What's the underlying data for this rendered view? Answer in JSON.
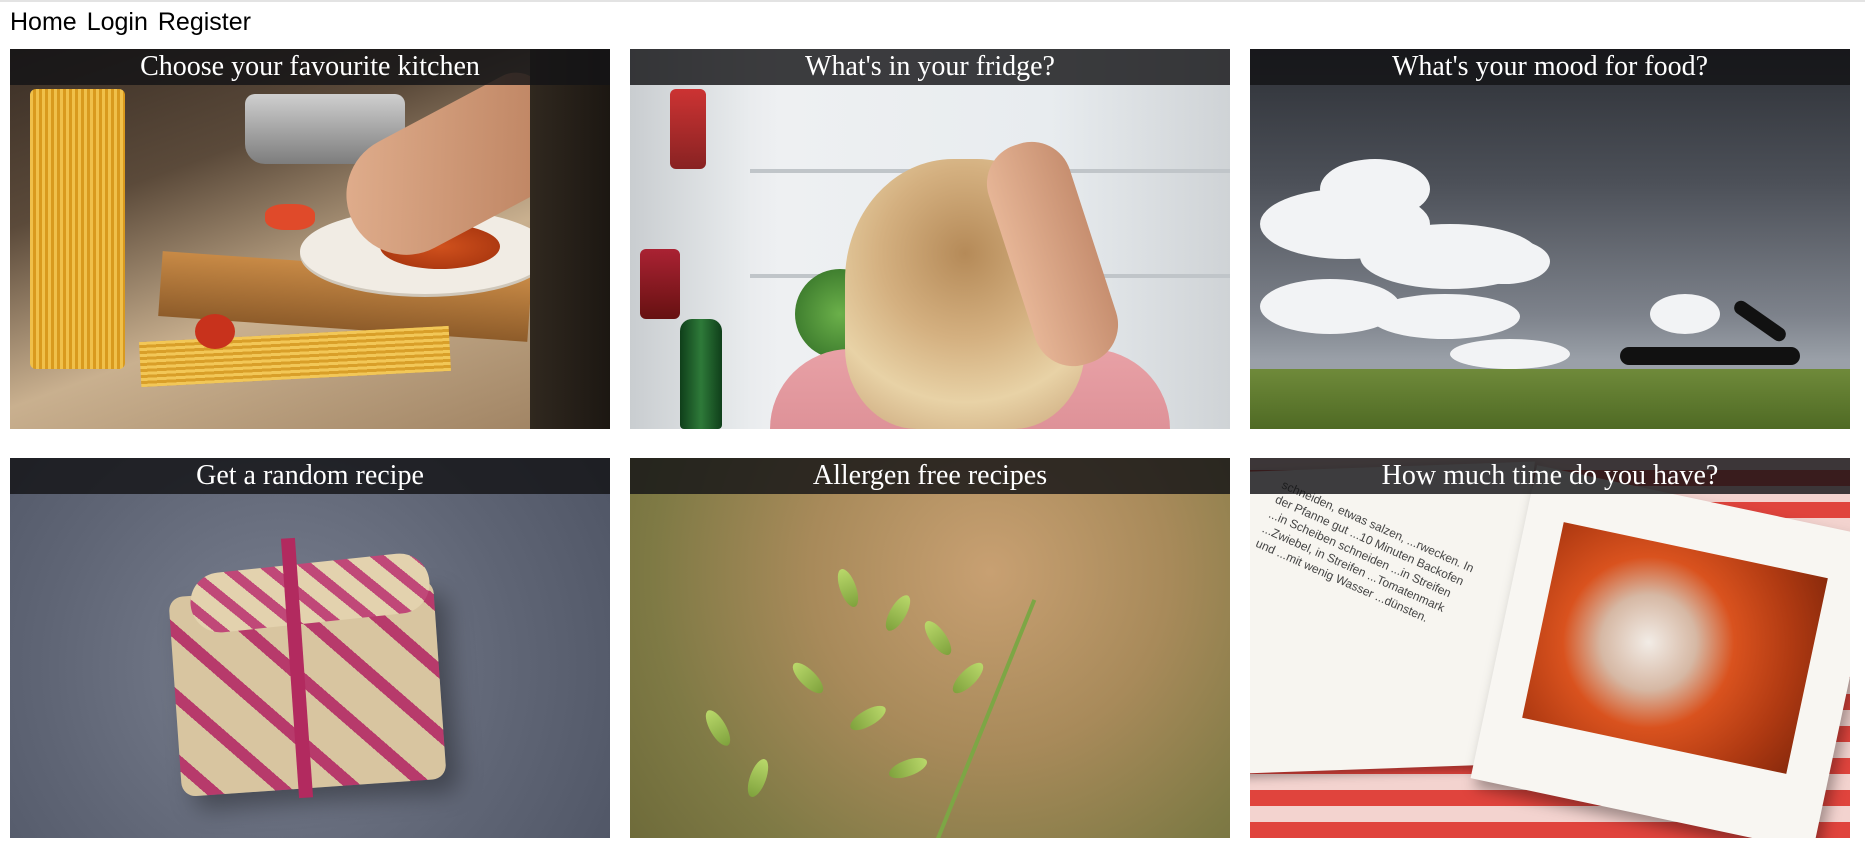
{
  "nav": {
    "home": "Home",
    "login": "Login",
    "register": "Register"
  },
  "cards": [
    {
      "title": "Choose your favourite kitchen"
    },
    {
      "title": "What's in your fridge?"
    },
    {
      "title": "What's your mood for food?"
    },
    {
      "title": "Get a random recipe"
    },
    {
      "title": "Allergen free recipes"
    },
    {
      "title": "How much time do you have?"
    }
  ],
  "book_text": "schneiden, etwas salzen, ...rwecken. In der Pfanne gut ...10 Minuten Backofen ...in Scheiben schneiden ...in Streifen ...Zwiebel, in Streifen ...Tomatenmark und ...mit wenig Wasser ...dünsten."
}
